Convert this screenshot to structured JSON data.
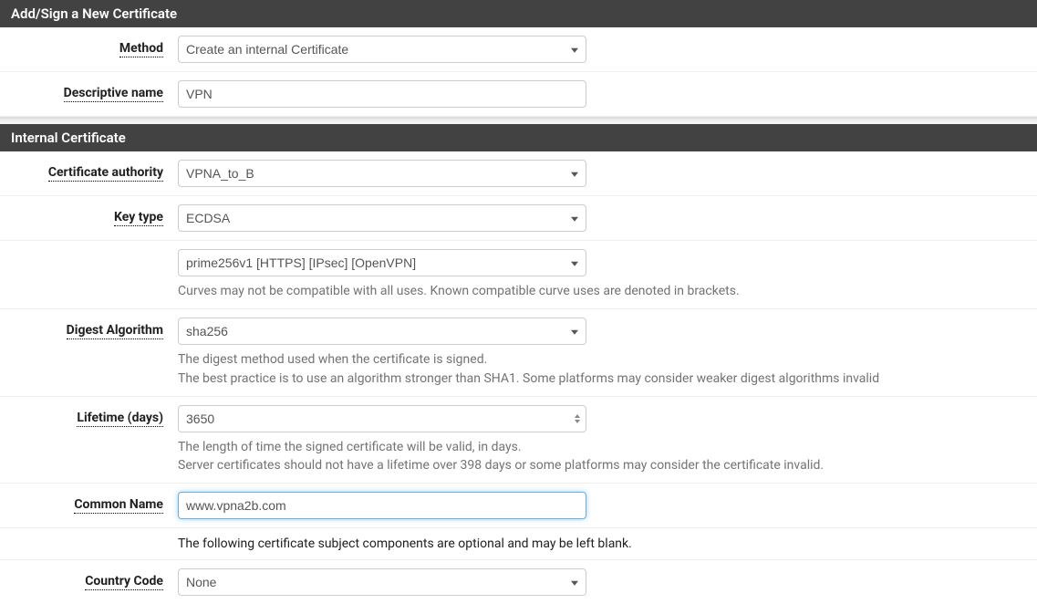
{
  "panel1": {
    "title": "Add/Sign a New Certificate"
  },
  "panel2": {
    "title": "Internal Certificate"
  },
  "method": {
    "label": "Method",
    "value": "Create an internal Certificate"
  },
  "descriptive_name": {
    "label": "Descriptive name",
    "value": "VPN"
  },
  "ca": {
    "label": "Certificate authority",
    "value": "VPNA_to_B"
  },
  "key_type": {
    "label": "Key type",
    "value": "ECDSA"
  },
  "curve": {
    "value": "prime256v1 [HTTPS] [IPsec] [OpenVPN]",
    "help": "Curves may not be compatible with all uses. Known compatible curve uses are denoted in brackets."
  },
  "digest": {
    "label": "Digest Algorithm",
    "value": "sha256",
    "help1": "The digest method used when the certificate is signed.",
    "help2": "The best practice is to use an algorithm stronger than SHA1. Some platforms may consider weaker digest algorithms invalid"
  },
  "lifetime": {
    "label": "Lifetime (days)",
    "value": "3650",
    "help1": "The length of time the signed certificate will be valid, in days.",
    "help2": "Server certificates should not have a lifetime over 398 days or some platforms may consider the certificate invalid."
  },
  "common_name": {
    "label": "Common Name",
    "value": "www.vpna2b.com"
  },
  "optional_note": "The following certificate subject components are optional and may be left blank.",
  "country": {
    "label": "Country Code",
    "value": "None"
  }
}
